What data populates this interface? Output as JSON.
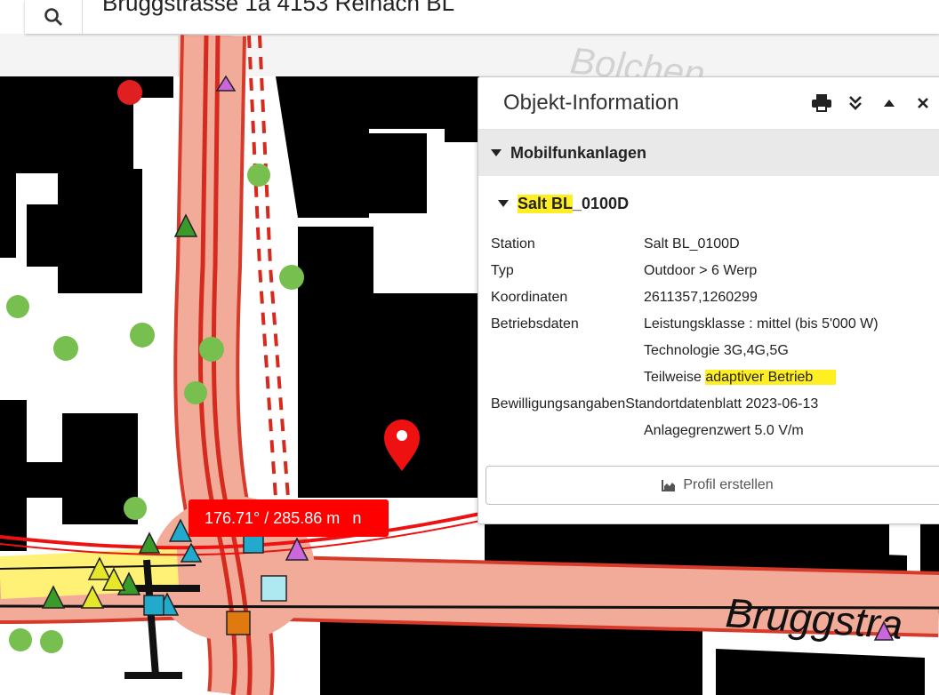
{
  "search": {
    "value": "Bruggstrasse 1a 4153 Reinach BL"
  },
  "map": {
    "street_label_top": "Bolchen",
    "street_label_bottom": "Bruggstra",
    "measure_value": "176.71° / 285.86 m",
    "measure_tail": "n"
  },
  "panel": {
    "title": "Objekt-Information",
    "section": "Mobilfunkanlagen",
    "subsection_highlight": "Salt BL",
    "subsection_rest": "_0100D",
    "rows": [
      {
        "key": "Station",
        "value": "Salt BL_0100D"
      },
      {
        "key": "Typ",
        "value": "Outdoor > 6 Werp"
      },
      {
        "key": "Koordinaten",
        "value": "2611357,1260299"
      },
      {
        "key": "Betriebsdaten",
        "value": "Leistungsklasse : mittel (bis 5'000 W)"
      },
      {
        "key": "",
        "value": "Technologie 3G,4G,5G"
      },
      {
        "key": "",
        "value": "Teilweise ",
        "value_highlight": "adaptiver Betrieb"
      },
      {
        "key": "Bewilligungsangaben",
        "value": "Standortdatenblatt 2023-06-13"
      },
      {
        "key": "",
        "value": "Anlagegrenzwert 5.0 V/m"
      }
    ],
    "profile_button": "Profil erstellen"
  },
  "colors": {
    "road_fill": "#f2ab98",
    "road_outline": "#d63a2a",
    "building": "#000000",
    "tree": "#77bf4f",
    "marker": "#ff0000",
    "highlight": "#ffee22"
  },
  "icons": [
    "search-icon",
    "print-icon",
    "chevrons-down-icon",
    "caret-up-icon",
    "close-icon",
    "location-pin-icon",
    "chart-icon"
  ]
}
